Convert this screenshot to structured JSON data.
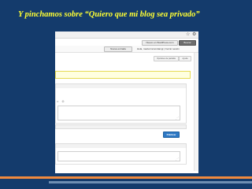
{
  "slide": {
    "title": "Y pinchamos sobre “Quiero que mi blog sea privado”",
    "colors": {
      "background": "#143B6C",
      "title": "#FFFF33",
      "accent_bar": "#F08A3E",
      "secondary_bar": "#6F8FB3"
    }
  },
  "screenshot": {
    "toolbar": {
      "icons": [
        "star-icon",
        "wrench-icon"
      ],
      "buttons": [
        "Nuevo en WordPress.com",
        "Buscar"
      ]
    },
    "admin_bar": {
      "dropdown": "Nueva entrada",
      "greeting": "Hola, maxtermcomdamgi | Cerrar sesión"
    },
    "tabs": [
      "Opciones de pantalla",
      "Ayuda"
    ],
    "submit_button": "Publicar",
    "colors": {
      "notice_bg": "#FFFFE0",
      "notice_border": "#E6DB55",
      "primary": "#2E79C5"
    }
  }
}
